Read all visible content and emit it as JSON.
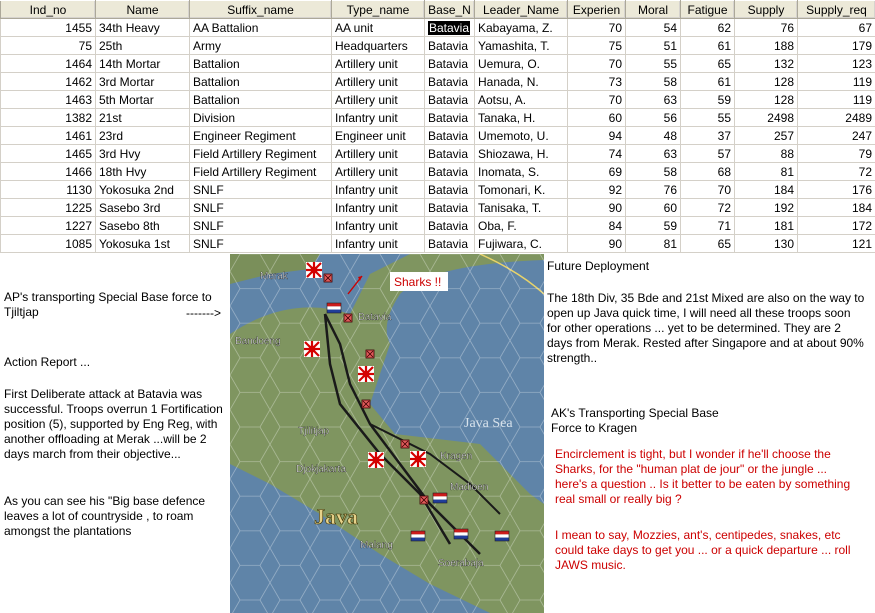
{
  "table": {
    "columns": [
      "Ind_no",
      "Name",
      "Suffix_name",
      "Type_name",
      "Base_N",
      "Leader_Name",
      "Experien",
      "Moral",
      "Fatigue",
      "Supply",
      "Supply_req"
    ],
    "rows": [
      [
        "1455",
        "34th Heavy",
        "AA Battalion",
        "AA unit",
        "Batavia",
        "Kabayama, Z.",
        "70",
        "54",
        "62",
        "76",
        "67"
      ],
      [
        "75",
        "25th",
        "Army",
        "Headquarters",
        "Batavia",
        "Yamashita, T.",
        "75",
        "51",
        "61",
        "188",
        "179"
      ],
      [
        "1464",
        "14th Mortar",
        "Battalion",
        "Artillery unit",
        "Batavia",
        "Uemura, O.",
        "70",
        "55",
        "65",
        "132",
        "123"
      ],
      [
        "1462",
        "3rd Mortar",
        "Battalion",
        "Artillery unit",
        "Batavia",
        "Hanada, N.",
        "73",
        "58",
        "61",
        "128",
        "119"
      ],
      [
        "1463",
        "5th Mortar",
        "Battalion",
        "Artillery unit",
        "Batavia",
        "Aotsu, A.",
        "70",
        "63",
        "59",
        "128",
        "119"
      ],
      [
        "1382",
        "21st",
        "Division",
        "Infantry unit",
        "Batavia",
        "Tanaka, H.",
        "60",
        "56",
        "55",
        "2498",
        "2489"
      ],
      [
        "1461",
        "23rd",
        "Engineer Regiment",
        "Engineer unit",
        "Batavia",
        "Umemoto, U.",
        "94",
        "48",
        "37",
        "257",
        "247"
      ],
      [
        "1465",
        "3rd Hvy",
        "Field Artillery Regiment",
        "Artillery unit",
        "Batavia",
        "Shiozawa, H.",
        "74",
        "63",
        "57",
        "88",
        "79"
      ],
      [
        "1466",
        "18th Hvy",
        "Field Artillery Regiment",
        "Artillery unit",
        "Batavia",
        "Inomata, S.",
        "69",
        "58",
        "68",
        "81",
        "72"
      ],
      [
        "1130",
        "Yokosuka 2nd",
        "SNLF",
        "Infantry unit",
        "Batavia",
        "Tomonari, K.",
        "92",
        "76",
        "70",
        "184",
        "176"
      ],
      [
        "1225",
        "Sasebo 3rd",
        "SNLF",
        "Infantry unit",
        "Batavia",
        "Tanisaka, T.",
        "90",
        "60",
        "72",
        "192",
        "184"
      ],
      [
        "1227",
        "Sasebo 8th",
        "SNLF",
        "Infantry unit",
        "Batavia",
        "Oba, F.",
        "84",
        "59",
        "71",
        "181",
        "172"
      ],
      [
        "1085",
        "Yokosuka 1st",
        "SNLF",
        "Infantry unit",
        "Batavia",
        "Fujiwara, C.",
        "90",
        "81",
        "65",
        "130",
        "121"
      ]
    ]
  },
  "left_notes": {
    "ap_transport": "AP's transporting Special Base force to Tjiltjap",
    "arrow": "------->",
    "action_title": "Action Report ...",
    "action_body": "First Deliberate attack at Batavia was successful. Troops overrun 1 Fortification position (5), supported by Eng Reg, with another offloading at Merak ...will be 2 days march from their objective...",
    "defence": "As you can see his \"Big base defence leaves a lot of countryside , to roam amongst the plantations"
  },
  "map": {
    "labels": {
      "merak": "Merak",
      "batavia": "Batavia",
      "bandoeng": "Bandoeng",
      "tjilitjap": "Tjilitjap",
      "djokjakarta": "Djokjakarta",
      "java": "Java",
      "java_sea": "Java Sea",
      "kragen": "Kragen",
      "madioen": "Madioen",
      "malang": "Malang",
      "soerabaja": "Soerabaja"
    },
    "callout": "Sharks !!",
    "colors": {
      "sea": "#5f84a8",
      "land": "#7f9560",
      "road": "#1a1a1a",
      "callout": "#cc0000"
    }
  },
  "right_notes": {
    "future_title": "Future Deployment",
    "future_body": "The 18th Div, 35 Bde and 21st Mixed are also on the way to open up Java quick time, I will need all these troops soon for other operations ... yet to be determined. They are 2 days from Merak. Rested after Singapore and at about 90% strength..",
    "ak_transport": "AK's Transporting Special Base Force to Kragen",
    "encirclement": "Encirclement is tight, but I wonder if he'll choose the Sharks, for the \"human plat de jour\" or the jungle ... here's a question .. Is it better to be eaten by something real small or really big ?",
    "mozzies": "I mean to say, Mozzies, ant's, centipedes, snakes, etc could take days to get you ... or a quick departure ... roll JAWS music."
  }
}
